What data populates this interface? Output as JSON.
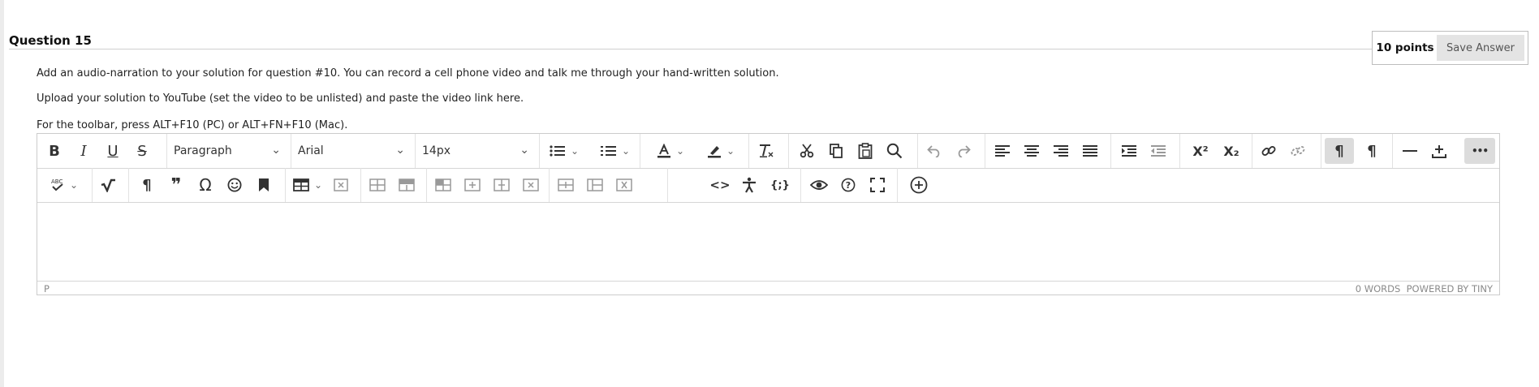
{
  "question": {
    "title": "Question 15",
    "points": "10 points",
    "save_label": "Save Answer",
    "paragraphs": [
      "Add an audio-narration to your solution for question #10. You can record a cell phone video and talk me through your hand-written solution.",
      "Upload your solution to YouTube (set the video to be unlisted) and paste the video link here.",
      "For the toolbar, press ALT+F10 (PC) or ALT+FN+F10 (Mac)."
    ]
  },
  "editor": {
    "block_format": "Paragraph",
    "font_family": "Arial",
    "font_size": "14px",
    "content": "",
    "status_path": "P",
    "word_count": "0 WORDS",
    "powered_by": "POWERED BY TINY",
    "toolbar_row1_icons": [
      "bold-icon",
      "italic-icon",
      "underline-icon",
      "strikethrough-icon",
      "bullet-list-icon",
      "numbered-list-icon",
      "text-color-icon",
      "highlight-icon",
      "clear-formatting-icon",
      "cut-icon",
      "copy-icon",
      "paste-icon",
      "search-icon",
      "undo-icon",
      "redo-icon",
      "align-left-icon",
      "align-center-icon",
      "align-right-icon",
      "justify-icon",
      "indent-icon",
      "outdent-icon",
      "superscript-icon",
      "subscript-icon",
      "link-icon",
      "unlink-icon",
      "ltr-icon",
      "rtl-icon",
      "horizontal-rule-icon",
      "insert-file-icon",
      "more-icon"
    ],
    "toolbar_row2_icons": [
      "spellcheck-icon",
      "math-icon",
      "paragraph-mark-icon",
      "blockquote-icon",
      "omega-icon",
      "emoji-icon",
      "bookmark-icon",
      "table-icon",
      "delete-table-icon",
      "row-before-icon",
      "row-after-icon",
      "delete-row-icon",
      "col-before-icon",
      "col-after-icon",
      "delete-col-icon",
      "split-cell-icon",
      "merge-cell-icon",
      "delete-cell-icon",
      "code-icon",
      "accessibility-icon",
      "code-sample-icon",
      "preview-icon",
      "help-icon",
      "fullscreen-icon",
      "add-content-icon"
    ]
  },
  "glyphs": {
    "bold": "B",
    "italic": "I",
    "underline": "U",
    "strike": "S",
    "pilcrow": "¶",
    "quote": "❞",
    "omega": "Ω",
    "ltr": "¶",
    "rtl": "¶",
    "superscript": "X²",
    "subscript": "X₂",
    "more": "•••",
    "code": "<>",
    "codesample": "{;}",
    "chevron": "⌄"
  }
}
